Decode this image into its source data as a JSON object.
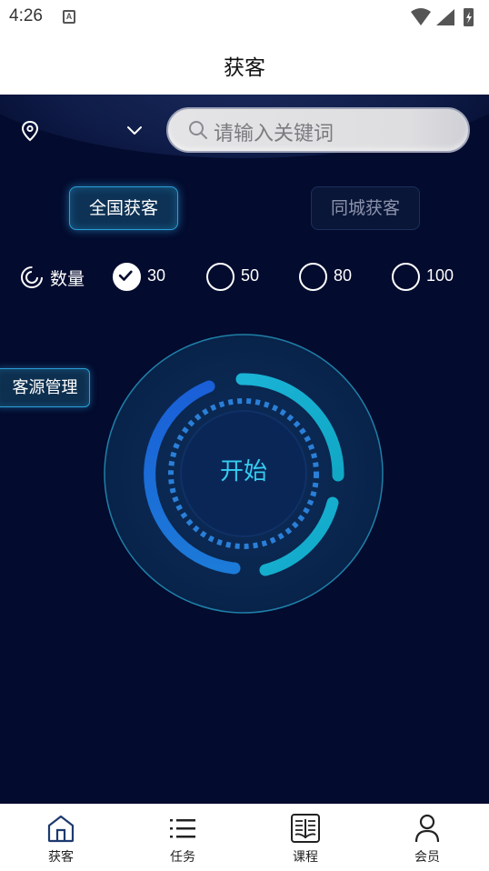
{
  "status_bar": {
    "time": "4:26",
    "notification_letter": "A"
  },
  "header": {
    "title": "获客"
  },
  "search": {
    "placeholder": "请输入关键词"
  },
  "tabs": [
    {
      "label": "全国获客",
      "active": true
    },
    {
      "label": "同城获客",
      "active": false
    }
  ],
  "quantity": {
    "label": "数量",
    "options": [
      {
        "value": "30",
        "checked": true
      },
      {
        "value": "50",
        "checked": false
      },
      {
        "value": "80",
        "checked": false
      },
      {
        "value": "100",
        "checked": false
      }
    ]
  },
  "customer_source_button": "客源管理",
  "start_button": "开始",
  "bottom_nav": [
    {
      "label": "获客",
      "icon": "home-icon",
      "active": true
    },
    {
      "label": "任务",
      "icon": "list-icon",
      "active": false
    },
    {
      "label": "课程",
      "icon": "book-icon",
      "active": false
    },
    {
      "label": "会员",
      "icon": "user-icon",
      "active": false
    }
  ],
  "colors": {
    "background": "#030b2e",
    "accent_cyan": "#34cdf0",
    "tab_active_border": "#2b9fd8",
    "nav_active": "#1c3a6e"
  }
}
